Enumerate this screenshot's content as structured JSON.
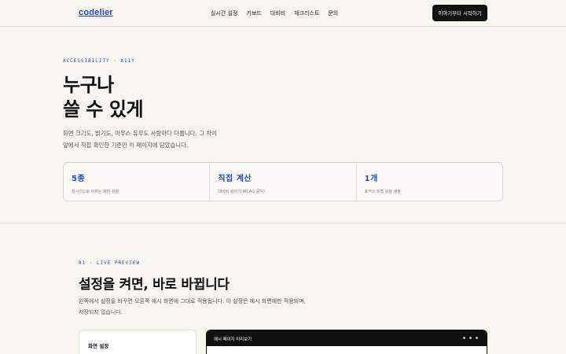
{
  "header": {
    "logo": "codelier",
    "nav": [
      "실시간 설정",
      "키보드",
      "대비비",
      "체크리스트",
      "문의"
    ],
    "cta_label": "이야기부터 시작하기"
  },
  "hero": {
    "eyebrow": "ACCESSIBILITY · A11Y",
    "title_line1": "누구나",
    "title_line2": "쓸 수 있게",
    "desc_line1": "화면 크기도, 밝기도, 마우스 유무도 사람마다 다릅니다. 그 차이",
    "desc_line2": "앞에서 직접 확인한 기준만 이 페이지에 담았습니다."
  },
  "stats": [
    {
      "value": "5종",
      "label": "실시간으로 바뀌는 화면 설정"
    },
    {
      "value": "직접 계산",
      "label": "대비비 검사기(WCAG 공식)"
    },
    {
      "value": "1개",
      "label": "포커스 트랩 모달 샘플"
    }
  ],
  "section": {
    "eyebrow": "01 · LIVE PREVIEW",
    "title": "설정을 켜면, 바로 바뀝니다",
    "desc_line1": "왼쪽에서 설정을 바꾸면 오른쪽 예시 화면에 그대로 적용됩니다. 이 설정은 예시 화면에만 적용되며,",
    "desc_line2": "저장되지 않습니다."
  },
  "settings_panel": {
    "title": "화면 설정"
  },
  "preview": {
    "title": "예시 페이지 미리보기",
    "window_dots_icon": "window-dots-icon"
  }
}
